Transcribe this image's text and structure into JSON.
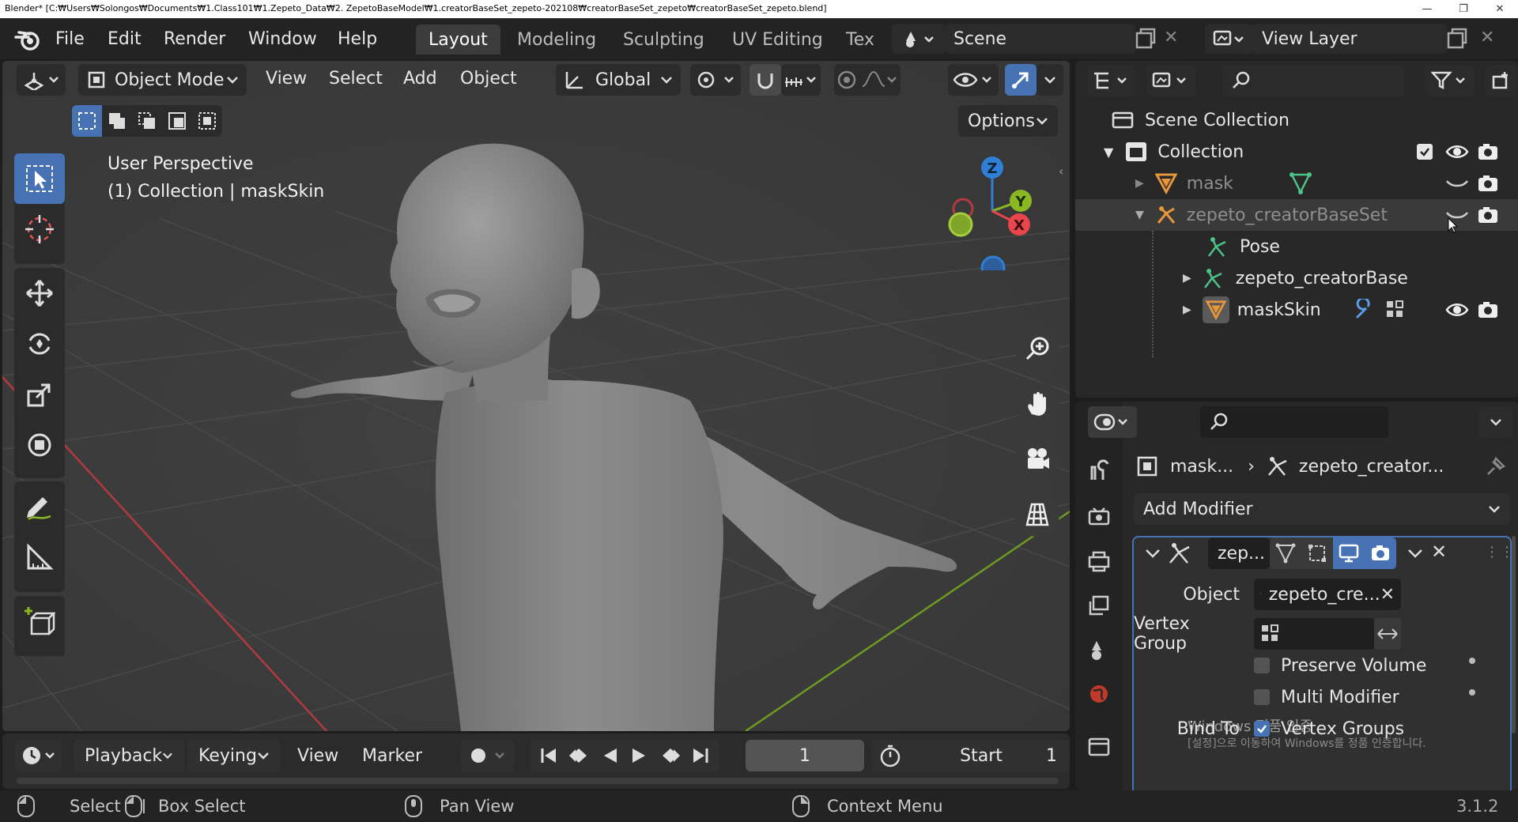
{
  "window": {
    "title": "Blender* [C:₩Users₩Solongos₩Documents₩1.Class101₩1.Zepeto_Data₩2. ZepetoBaseModel₩1.creatorBaseSet_zepeto-202108₩creatorBaseSet_zepeto₩creatorBaseSet_zepeto.blend]",
    "minimize": "—",
    "maximize": "❐",
    "close": "✕"
  },
  "menubar": {
    "items": [
      "File",
      "Edit",
      "Render",
      "Window",
      "Help"
    ],
    "workspaces": [
      "Layout",
      "Modeling",
      "Sculpting",
      "UV Editing",
      "Tex"
    ],
    "active_workspace": "Layout",
    "scene": "Scene",
    "view_layer": "View Layer"
  },
  "viewport": {
    "mode": "Object Mode",
    "menus": [
      "View",
      "Select",
      "Add",
      "Object"
    ],
    "orientation": "Global",
    "options": "Options",
    "overlay_title": "User Perspective",
    "overlay_subtitle": "(1) Collection | maskSkin",
    "gizmo": {
      "z": "Z",
      "y": "Y",
      "x": "X"
    }
  },
  "timeline": {
    "playback": "Playback",
    "keying": "Keying",
    "view": "View",
    "marker": "Marker",
    "current_frame": "1",
    "start_label": "Start",
    "start_value": "1"
  },
  "statusbar": {
    "select": "Select",
    "box_select": "Box Select",
    "pan_view": "Pan View",
    "context_menu": "Context Menu",
    "version": "3.1.2"
  },
  "outliner": {
    "scene_collection": "Scene Collection",
    "collection": "Collection",
    "items": [
      "mask",
      "zepeto_creatorBaseSet",
      "Pose",
      "zepeto_creatorBase!",
      "maskSkin"
    ]
  },
  "properties": {
    "breadcrumb_object": "mask...",
    "breadcrumb_modifier": "zepeto_creator...",
    "add_modifier": "Add Modifier",
    "modifier_name": "zep...",
    "object_label": "Object",
    "object_value": "zepeto_cre...",
    "vertex_group_label": "Vertex Group",
    "vertex_group_value": "",
    "preserve_volume": "Preserve Volume",
    "multi_modifier": "Multi Modifier",
    "bind_to": "Bind To",
    "vertex_groups": "Vertex Groups",
    "watermark_line1": "Windows 정품 인증",
    "watermark_line2": "[설정]으로 이동하여 Windows를 정품 인증합니다."
  },
  "colors": {
    "accent": "#4772b3",
    "x_axis": "#e8464c",
    "y_axis": "#8ab823",
    "z_axis": "#2f7fd6",
    "background": "#3d3d3d"
  }
}
